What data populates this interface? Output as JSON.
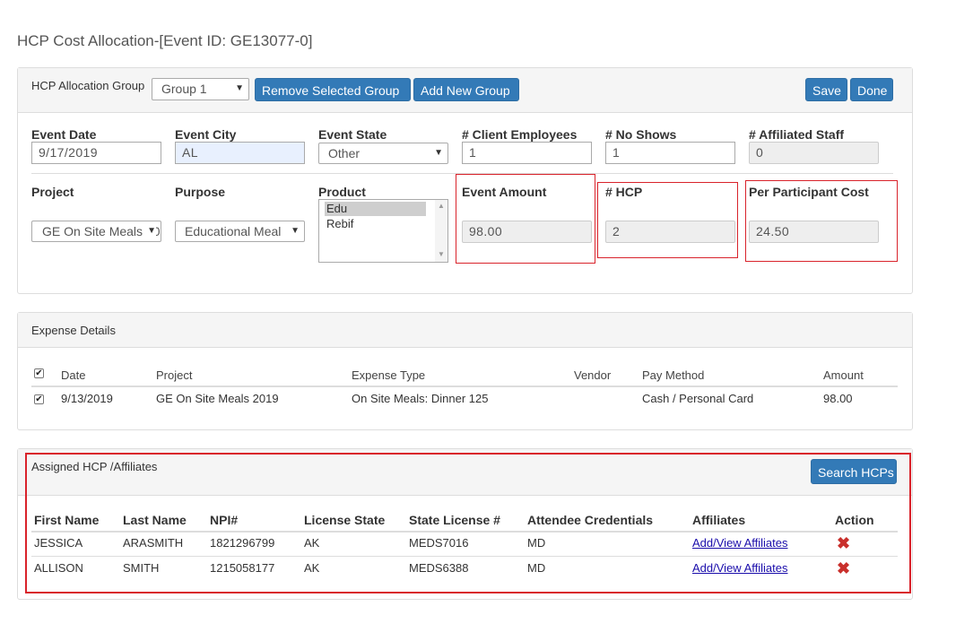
{
  "page": {
    "title": "HCP Cost Allocation-[Event ID: GE13077-0]"
  },
  "allocation": {
    "group_label": "HCP Allocation Group",
    "group_value": "Group 1",
    "remove_label": "Remove Selected Group",
    "add_label": "Add New Group",
    "save_label": "Save",
    "done_label": "Done"
  },
  "event": {
    "date_label": "Event Date",
    "date_value": "9/17/2019",
    "city_label": "Event City",
    "city_value": "AL",
    "state_label": "Event State",
    "state_value": "Other",
    "client_emp_label": "# Client Employees",
    "client_emp_value": "1",
    "no_shows_label": "# No Shows",
    "no_shows_value": "1",
    "affiliated_label": "# Affiliated Staff",
    "affiliated_value": "0",
    "project_label": "Project",
    "project_value": "GE On Site Meals 2019",
    "purpose_label": "Purpose",
    "purpose_value": "Educational Meal",
    "product_label": "Product",
    "product_options": [
      "Edu",
      "Rebif"
    ],
    "amount_label": "Event Amount",
    "amount_value": "98.00",
    "hcp_label": "# HCP",
    "hcp_value": "2",
    "ppc_label": "Per Participant Cost",
    "ppc_value": "24.50"
  },
  "expense": {
    "title": "Expense Details",
    "headers": [
      "Date",
      "Project",
      "Expense Type",
      "Vendor",
      "Pay Method",
      "Amount"
    ],
    "rows": [
      {
        "date": "9/13/2019",
        "project": "GE On Site Meals 2019",
        "type": "On Site Meals: Dinner 125",
        "vendor": "",
        "pay": "Cash / Personal Card",
        "amount": "98.00"
      }
    ]
  },
  "hcp": {
    "title": "Assigned HCP /Affiliates",
    "search_label": "Search HCPs",
    "headers": [
      "First Name",
      "Last Name",
      "NPI#",
      "License State",
      "State License #",
      "Attendee Credentials",
      "Affiliates",
      "Action"
    ],
    "rows": [
      {
        "first": "JESSICA",
        "last": "ARASMITH",
        "npi": "1821296799",
        "lic_state": "AK",
        "lic": "MEDS7016",
        "cred": "MD",
        "affiliates": "Add/View Affiliates",
        "action_icon": "delete-x-icon"
      },
      {
        "first": "ALLISON",
        "last": "SMITH",
        "npi": "1215058177",
        "lic_state": "AK",
        "lic": "MEDS6388",
        "cred": "MD",
        "affiliates": "Add/View Affiliates",
        "action_icon": "delete-x-icon"
      }
    ]
  },
  "colors": {
    "primary": "#337ab7",
    "highlight_border": "#d9232b",
    "delete": "#c9302c"
  }
}
